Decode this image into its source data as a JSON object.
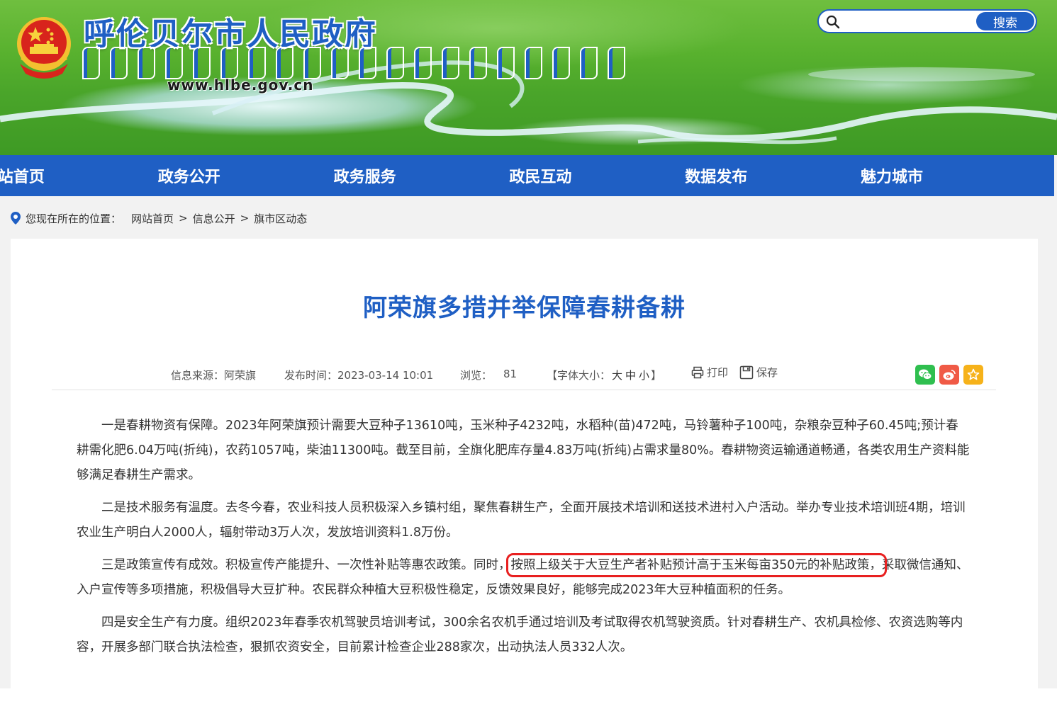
{
  "header": {
    "site_title": "呼伦贝尔市人民政府",
    "site_url": "www.hlbe.gov.cn",
    "search": {
      "placeholder": "",
      "button_label": "搜索"
    }
  },
  "nav": {
    "items": [
      {
        "label": "网站首页"
      },
      {
        "label": "政务公开"
      },
      {
        "label": "政务服务"
      },
      {
        "label": "政民互动"
      },
      {
        "label": "数据发布"
      },
      {
        "label": "魅力城市"
      }
    ]
  },
  "breadcrumb": {
    "lead": "您现在所在的位置：",
    "items": [
      "网站首页",
      "信息公开",
      "旗市区动态"
    ],
    "separator": ">"
  },
  "article": {
    "title": "阿荣旗多措并举保障春耕备耕",
    "meta": {
      "source": "信息来源：阿荣旗",
      "publish_time": "发布时间：2023-03-14 10:01",
      "views_label": "浏览：",
      "views": "81",
      "font_size_prefix": "【字体大小：",
      "font_large": "大",
      "font_medium": "中",
      "font_small": "小",
      "font_size_suffix": "】",
      "print_label": "打印",
      "save_label": "保存"
    },
    "paragraphs": {
      "p1": "一是春耕物资有保障。2023年阿荣旗预计需要大豆种子13610吨，玉米种子4232吨，水稻种(苗)472吨，马铃薯种子100吨，杂粮杂豆种子60.45吨;预计春耕需化肥6.04万吨(折纯)，农药1057吨，柴油11300吨。截至目前，全旗化肥库存量4.83万吨(折纯)占需求量80%。春耕物资运输通道畅通，各类农用生产资料能够满足春耕生产需求。",
      "p2": "二是技术服务有温度。去冬今春，农业科技人员积极深入乡镇村组，聚焦春耕生产，全面开展技术培训和送技术进村入户活动。举办专业技术培训班4期，培训农业生产明白人2000人，辐射带动3万人次，发放培训资料1.8万份。",
      "p3_before": "三是政策宣传有成效。积极宣传产能提升、一次性补贴等惠农政策。同时，",
      "p3_highlight": "按照上级关于大豆生产者补贴预计高于玉米每亩350元的补贴政策，",
      "p3_after": "采取微信通知、入户宣传等多项措施，积极倡导大豆扩种。农民群众种植大豆积极性稳定，反馈效果良好，能够完成2023年大豆种植面积的任务。",
      "p4": "四是安全生产有力度。组织2023年春季农机驾驶员培训考试，300余名农机手通过培训及考试取得农机驾驶资质。针对春耕生产、农机具检修、农资选购等内容，开展多部门联合执法检查，狠抓农资安全，目前累计检查企业288家次，出动执法人员332人次。"
    }
  },
  "colors": {
    "brand_blue": "#1f5fc4",
    "highlight_red": "#e82020",
    "wechat_green": "#2fbf4f",
    "weibo_red": "#f05a46",
    "favorite_yellow": "#f6b21a"
  },
  "icons": {
    "search": "search-icon",
    "location": "location-pin-icon",
    "print": "printer-icon",
    "save": "floppy-disk-icon",
    "wechat": "wechat-icon",
    "weibo": "weibo-icon",
    "favorite": "star-icon",
    "emblem": "national-emblem-icon"
  }
}
